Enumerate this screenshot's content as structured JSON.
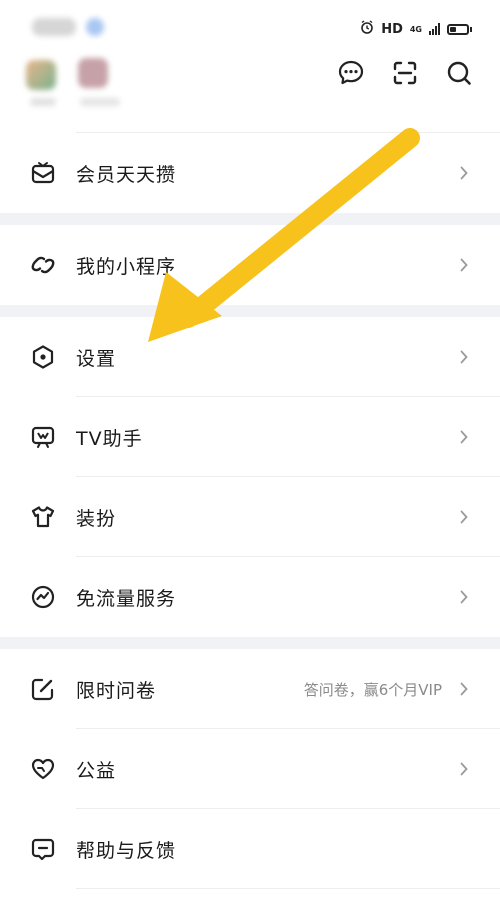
{
  "status_bar": {
    "network_label": "HD",
    "network_type": "4G"
  },
  "header": {
    "icons": [
      "chat-bubble-icon",
      "scan-icon",
      "search-icon"
    ]
  },
  "menu": {
    "items": [
      {
        "label": "会员天天攒",
        "icon": "gift-box-icon"
      },
      {
        "label": "我的小程序",
        "icon": "mini-program-icon"
      },
      {
        "label": "设置",
        "icon": "settings-hexagon-icon"
      },
      {
        "label": "TV助手",
        "icon": "tv-icon"
      },
      {
        "label": "装扮",
        "icon": "shirt-icon"
      },
      {
        "label": "免流量服务",
        "icon": "data-service-icon"
      },
      {
        "label": "限时问卷",
        "icon": "survey-edit-icon",
        "hint": "答问卷，赢6个月VIP"
      },
      {
        "label": "公益",
        "icon": "charity-heart-icon"
      },
      {
        "label": "帮助与反馈",
        "icon": "help-feedback-icon"
      }
    ]
  },
  "colors": {
    "accent_arrow": "#f7c21b",
    "section_gap": "#f1f2f6",
    "text_primary": "#1a1a1a",
    "text_hint": "#8a8a8a"
  }
}
